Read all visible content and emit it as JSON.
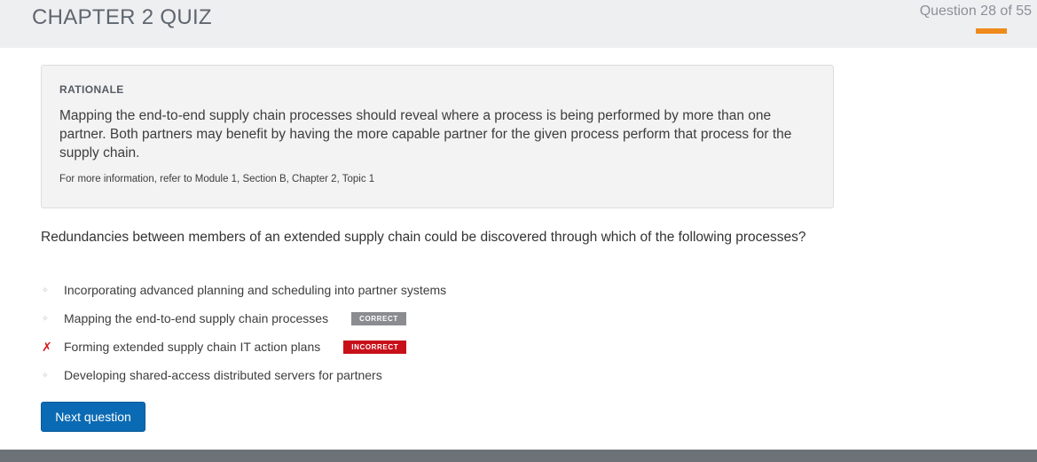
{
  "header": {
    "title": "CHAPTER 2 QUIZ",
    "progress_text": "Question 28 of 55",
    "progress_fraction": 0.509,
    "accent_color": "#ef8a1c"
  },
  "rationale": {
    "heading": "RATIONALE",
    "text": "Mapping the end-to-end supply chain processes should reveal where a process is being performed by more than one partner. Both partners may benefit by having the more capable partner for the given process perform that process for the supply chain.",
    "reference": "For more information, refer to Module 1, Section B, Chapter 2, Topic 1"
  },
  "question": {
    "text": "Redundancies between members of an extended supply chain could be discovered through which of the following processes?"
  },
  "options": [
    {
      "label": "Incorporating advanced planning and scheduling into partner systems",
      "marker": "✧",
      "badge": ""
    },
    {
      "label": "Mapping the end-to-end supply chain processes",
      "marker": "✧",
      "badge": "CORRECT"
    },
    {
      "label": "Forming extended supply chain IT action plans",
      "marker": "✗",
      "badge": "INCORRECT"
    },
    {
      "label": "Developing shared-access distributed servers for partners",
      "marker": "✧",
      "badge": ""
    }
  ],
  "actions": {
    "next_label": "Next question"
  },
  "colors": {
    "primary_button": "#0a6ab4",
    "correct_badge": "#8a8c90",
    "incorrect_badge": "#c8101a",
    "wrong_mark": "#d21c1c"
  }
}
